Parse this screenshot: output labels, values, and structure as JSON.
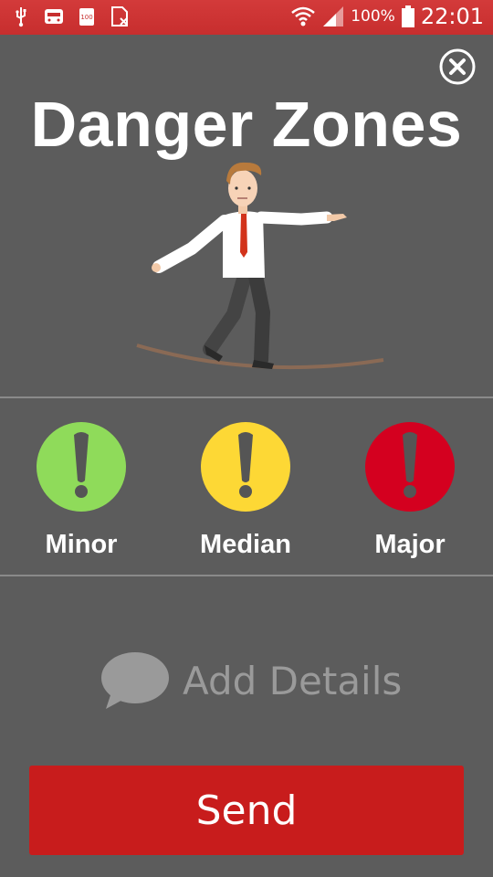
{
  "status_bar": {
    "battery_text": "100%",
    "time": "22:01",
    "icons": [
      "usb-icon",
      "notification-icon",
      "battery-saver-icon",
      "sim-icon",
      "wifi-icon",
      "signal-icon",
      "battery-icon"
    ]
  },
  "header": {
    "title": "Danger Zones",
    "close_icon": "close-icon"
  },
  "illustration": {
    "subject": "man-on-tightrope"
  },
  "levels": [
    {
      "label": "Minor",
      "color": "#8fdb5a",
      "icon": "exclamation-icon"
    },
    {
      "label": "Median",
      "color": "#fdd835",
      "icon": "exclamation-icon"
    },
    {
      "label": "Major",
      "color": "#d4001f",
      "icon": "exclamation-icon"
    }
  ],
  "details": {
    "placeholder": "Add Details",
    "icon": "chat-bubble-icon"
  },
  "actions": {
    "send_label": "Send",
    "send_color": "#c81c1c"
  },
  "colors": {
    "status_bar": "#c72e2e",
    "background": "#5c5c5c"
  }
}
